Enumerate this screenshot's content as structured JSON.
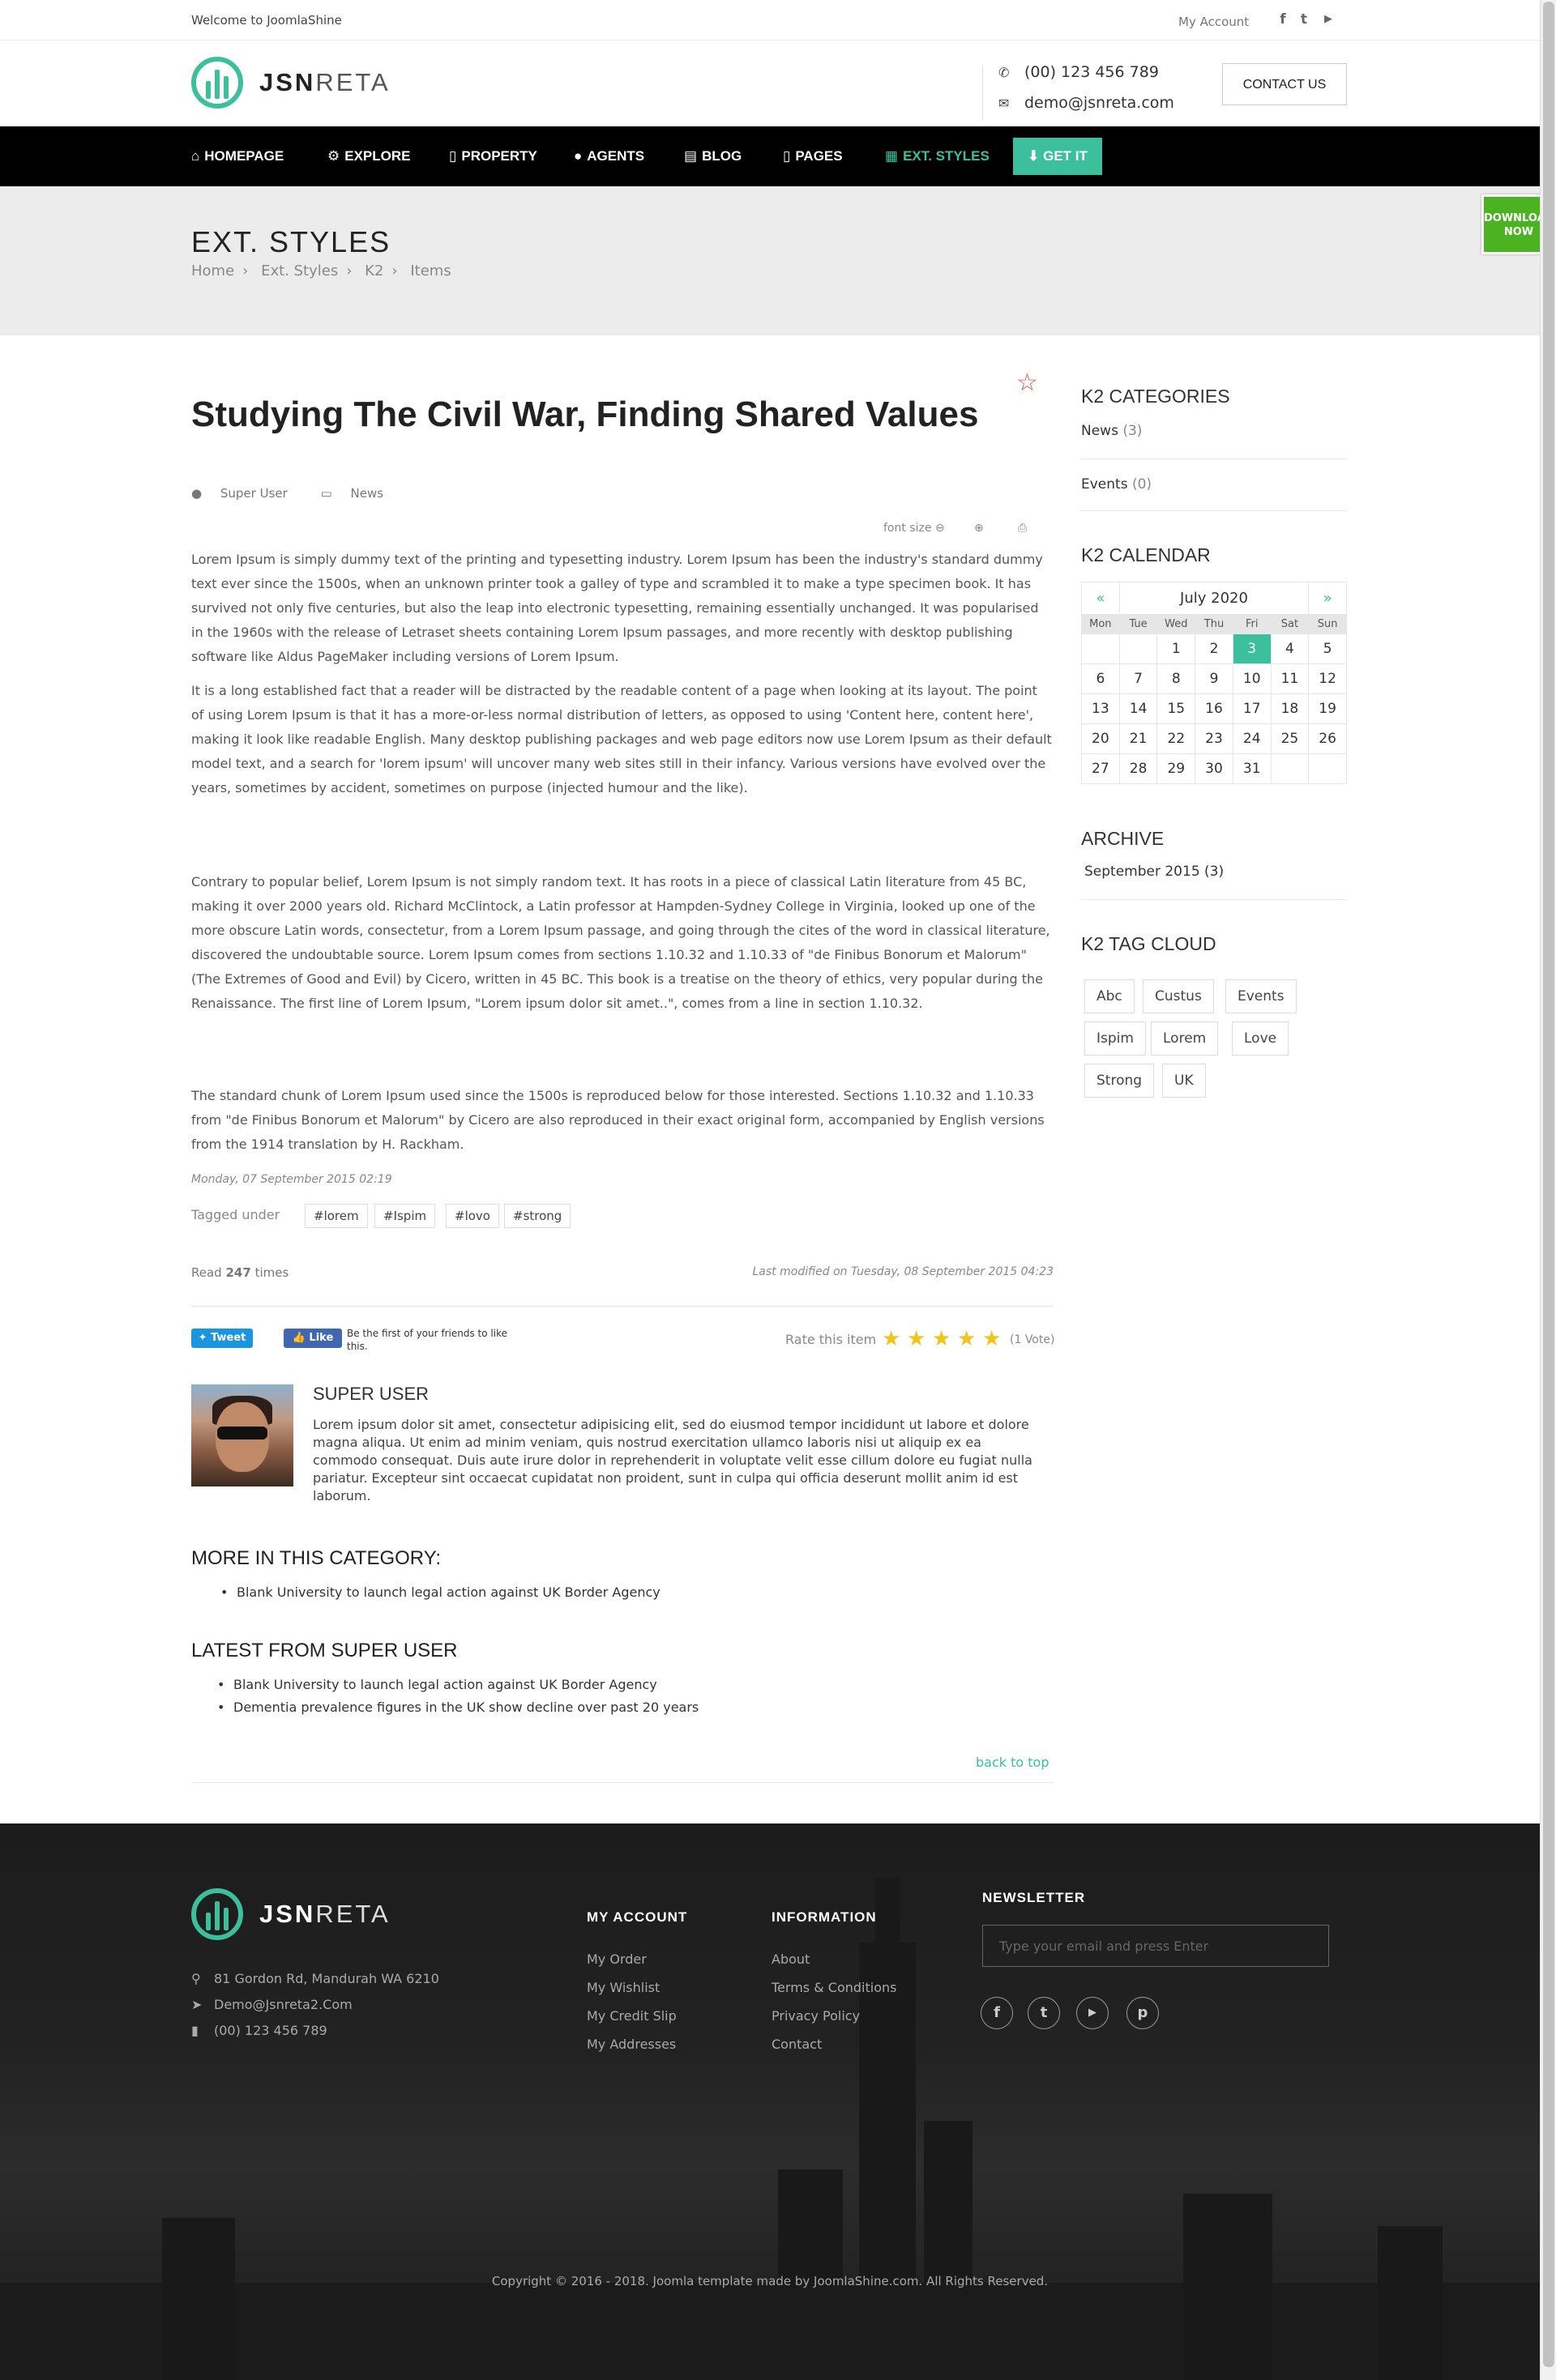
{
  "topbar": {
    "welcome": "Welcome to JoomlaShine",
    "my_account": "My Account",
    "social": [
      "facebook-icon",
      "twitter-icon",
      "youtube-icon"
    ]
  },
  "header": {
    "logo_bold": "JSN",
    "logo_light": "RETA",
    "phone": "(00) 123 456 789",
    "email": "demo@jsnreta.com",
    "contact_button": "CONTACT US"
  },
  "nav": {
    "items": [
      "HOMEPAGE",
      "EXPLORE",
      "PROPERTY",
      "AGENTS",
      "BLOG",
      "PAGES",
      "EXT. STYLES"
    ],
    "get_it": "GET IT",
    "accent": "#3cbf9c"
  },
  "download_badge": {
    "line1": "DOWNLOAD",
    "line2": "NOW"
  },
  "page_head": {
    "title": "EXT. STYLES",
    "breadcrumb": [
      "Home",
      "Ext. Styles",
      "K2",
      "Items"
    ],
    "sep": "›"
  },
  "article": {
    "title": "Studying The Civil War, Finding Shared Values",
    "author": "Super User",
    "category": "News",
    "font_size_label": "font size",
    "paragraphs": [
      "Lorem Ipsum is simply dummy text of the printing and typesetting industry. Lorem Ipsum has been the industry's standard dummy text ever since the 1500s, when an unknown printer took a galley of type and scrambled it to make a type specimen book. It has survived not only five centuries, but also the leap into electronic typesetting, remaining essentially unchanged. It was popularised in the 1960s with the release of Letraset sheets containing Lorem Ipsum passages, and more recently with desktop publishing software like Aldus PageMaker including versions of Lorem Ipsum.",
      "It is a long established fact that a reader will be distracted by the readable content of a page when looking at its layout. The point of using Lorem Ipsum is that it has a more-or-less normal distribution of letters, as opposed to using 'Content here, content here', making it look like readable English. Many desktop publishing packages and web page editors now use Lorem Ipsum as their default model text, and a search for 'lorem ipsum' will uncover many web sites still in their infancy. Various versions have evolved over the years, sometimes by accident, sometimes on purpose (injected humour and the like).",
      "Contrary to popular belief, Lorem Ipsum is not simply random text. It has roots in a piece of classical Latin literature from 45 BC, making it over 2000 years old. Richard McClintock, a Latin professor at Hampden-Sydney College in Virginia, looked up one of the more obscure Latin words, consectetur, from a Lorem Ipsum passage, and going through the cites of the word in classical literature, discovered the undoubtable source. Lorem Ipsum comes from sections 1.10.32 and 1.10.33 of \"de Finibus Bonorum et Malorum\" (The Extremes of Good and Evil) by Cicero, written in 45 BC. This book is a treatise on the theory of ethics, very popular during the Renaissance. The first line of Lorem Ipsum, \"Lorem ipsum dolor sit amet..\", comes from a line in section 1.10.32.",
      "The standard chunk of Lorem Ipsum used since the 1500s is reproduced below for those interested. Sections 1.10.32 and 1.10.33 from \"de Finibus Bonorum et Malorum\" by Cicero are also reproduced in their exact original form, accompanied by English versions from the 1914 translation by H. Rackham."
    ],
    "date": "Monday, 07 September 2015 02:19",
    "tagged_label": "Tagged under",
    "tags": [
      "#lorem",
      "#Ispim",
      "#lovo",
      "#strong"
    ],
    "read_prefix": "Read",
    "read_count": "247",
    "read_suffix": "times",
    "last_modified": "Last modified on Tuesday, 08 September 2015 04:23",
    "tweet": "Tweet",
    "like": "Like",
    "like_text": "Be the first of your friends to like this.",
    "rate_label": "Rate this item",
    "rating": 5,
    "votes": "(1 Vote)"
  },
  "author_box": {
    "name": "SUPER USER",
    "bio": "Lorem ipsum dolor sit amet, consectetur adipisicing elit, sed do eiusmod tempor incididunt ut labore et dolore magna aliqua. Ut enim ad minim veniam, quis nostrud exercitation ullamco laboris nisi ut aliquip ex ea commodo consequat. Duis aute irure dolor in reprehenderit in voluptate velit esse cillum dolore eu fugiat nulla pariatur. Excepteur sint occaecat cupidatat non proident, sunt in culpa qui officia deserunt mollit anim id est laborum."
  },
  "more_in_category": {
    "title": "MORE IN THIS CATEGORY:",
    "items": [
      "Blank University to launch legal action against UK Border Agency"
    ]
  },
  "latest_from_user": {
    "title": "LATEST FROM SUPER USER",
    "items": [
      "Blank University to launch legal action against UK Border Agency",
      "Dementia prevalence figures in the UK show decline over past 20 years"
    ]
  },
  "back_to_top": "back to top",
  "sidebar": {
    "categories_title": "K2 CATEGORIES",
    "categories": [
      {
        "name": "News",
        "count": "(3)"
      },
      {
        "name": "Events",
        "count": "(0)"
      }
    ],
    "calendar_title": "K2 CALENDAR",
    "calendar": {
      "prev": "«",
      "next": "»",
      "month": "July 2020",
      "days": [
        "Mon",
        "Tue",
        "Wed",
        "Thu",
        "Fri",
        "Sat",
        "Sun"
      ],
      "weeks": [
        [
          "",
          "",
          "1",
          "2",
          "3",
          "4",
          "5"
        ],
        [
          "6",
          "7",
          "8",
          "9",
          "10",
          "11",
          "12"
        ],
        [
          "13",
          "14",
          "15",
          "16",
          "17",
          "18",
          "19"
        ],
        [
          "20",
          "21",
          "22",
          "23",
          "24",
          "25",
          "26"
        ],
        [
          "27",
          "28",
          "29",
          "30",
          "31",
          "",
          ""
        ]
      ],
      "today": "3"
    },
    "archive_title": "ARCHIVE",
    "archive": [
      "September 2015 (3)"
    ],
    "tagcloud_title": "K2 TAG CLOUD",
    "tagcloud": [
      "Abc",
      "Custus",
      "Events",
      "Ispim",
      "Lorem",
      "Love",
      "Strong",
      "UK"
    ]
  },
  "footer": {
    "logo_bold": "JSN",
    "logo_light": "RETA",
    "address": "81 Gordon Rd, Mandurah WA 6210",
    "email": "Demo@Jsnreta2.Com",
    "phone": "(00) 123 456 789",
    "my_account_title": "MY ACCOUNT",
    "my_account": [
      "My Order",
      "My Wishlist",
      "My Credit Slip",
      "My Addresses"
    ],
    "information_title": "INFORMATION",
    "information": [
      "About",
      "Terms & Conditions",
      "Privacy Policy",
      "Contact"
    ],
    "newsletter_title": "NEWSLETTER",
    "newsletter_placeholder": "Type your email and press Enter",
    "social": [
      "facebook-icon",
      "twitter-icon",
      "youtube-icon",
      "pinterest-icon"
    ],
    "copyright": "Copyright © 2016 - 2018. Joomla template made by JoomlaShine.com. All Rights Reserved."
  }
}
